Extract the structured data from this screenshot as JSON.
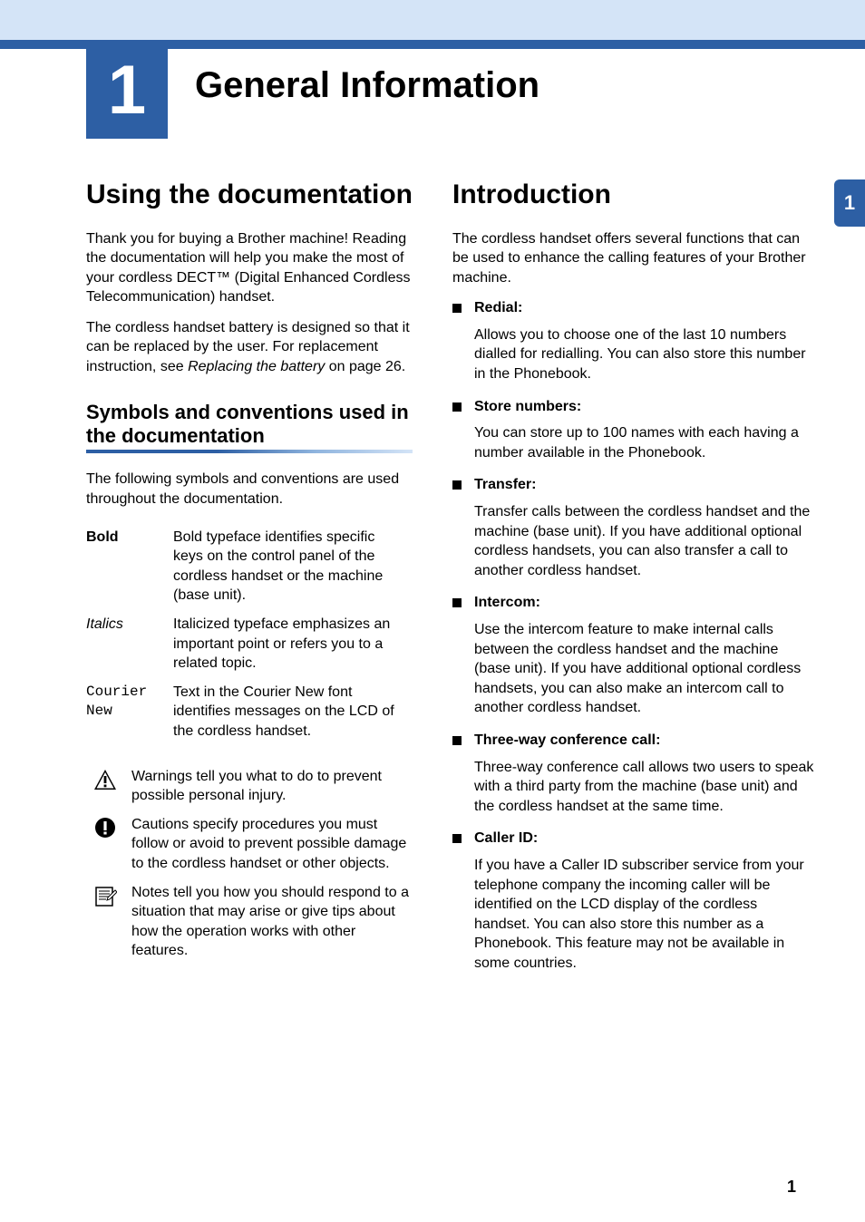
{
  "chapter": {
    "number": "1",
    "title": "General Information"
  },
  "side_tab": "1",
  "page_number": "1",
  "left": {
    "heading": "Using the documentation",
    "intro_part1": "Thank you for buying a Brother machine! Reading the documentation will help you make the most of your cordless DECT™ (Digital Enhanced Cordless Telecommunication) handset.",
    "intro_part2a": "The cordless handset battery is designed so that it can be replaced by the user. For replacement instruction, see ",
    "intro_part2_italic": "Replacing the battery",
    "intro_part2b": " on page 26.",
    "subheading": "Symbols and conventions used in the documentation",
    "subintro": "The following symbols and conventions are used throughout the documentation.",
    "conventions": {
      "bold": {
        "label": "Bold",
        "desc": "Bold typeface identifies specific keys on the control panel of the cordless handset or the machine (base unit)."
      },
      "italics": {
        "label": "Italics",
        "desc": "Italicized typeface emphasizes an important point or refers you to a related topic."
      },
      "courier": {
        "label": "Courier New",
        "desc": "Text in the Courier New font identifies messages on the LCD of the cordless handset."
      }
    },
    "icons": {
      "warning": "Warnings tell you what to do to prevent possible personal injury.",
      "caution": "Cautions specify procedures you must follow or avoid to prevent possible damage to the cordless handset or other objects.",
      "note": "Notes tell you how you should respond to a situation that may arise or give tips about how the operation works with other features."
    }
  },
  "right": {
    "heading": "Introduction",
    "intro": "The cordless handset offers several functions that can be used to enhance the calling features of your Brother machine.",
    "features": [
      {
        "title": "Redial:",
        "desc": "Allows you to choose one of the last 10 numbers dialled for redialling. You can also store this number in the Phonebook."
      },
      {
        "title": "Store numbers:",
        "desc": "You can store up to 100 names with each having a number available in the Phonebook."
      },
      {
        "title": "Transfer:",
        "desc": "Transfer calls between the cordless handset and the machine (base unit). If you have additional optional cordless handsets, you can also transfer a call to another cordless handset."
      },
      {
        "title": "Intercom:",
        "desc": "Use the intercom feature to make internal calls between the cordless handset and the machine (base unit). If you have additional optional cordless handsets, you can also make an intercom call to another cordless handset."
      },
      {
        "title": "Three-way conference call:",
        "desc": "Three-way conference call allows two users to speak with a third party from the machine (base unit) and the cordless handset at the same time."
      },
      {
        "title": "Caller ID:",
        "desc": "If you have a Caller ID subscriber service from your telephone company the incoming caller will be identified on the LCD display of the cordless handset. You can also store this number as a Phonebook. This feature may not be available in some countries."
      }
    ]
  }
}
